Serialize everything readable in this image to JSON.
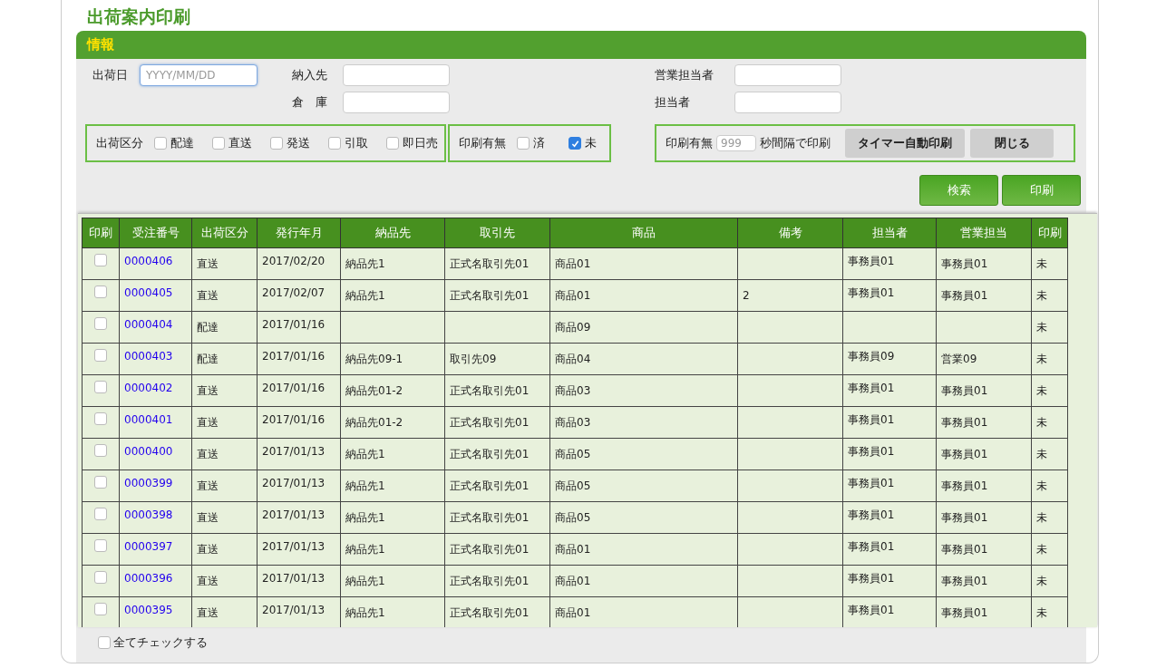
{
  "page_title": "出荷案内印刷",
  "panel": {
    "title": "情報",
    "fields": [
      {
        "label": "出荷日",
        "placeholder": "YYYY/MM/DD",
        "focused": true
      },
      {
        "label": "納入先"
      },
      {
        "label": "倉　庫"
      },
      {
        "label": "営業担当者"
      },
      {
        "label": "担当者"
      }
    ],
    "shipping_type": {
      "label": "出荷区分",
      "options": [
        {
          "label": "配達",
          "checked": false
        },
        {
          "label": "直送",
          "checked": false
        },
        {
          "label": "発送",
          "checked": false
        },
        {
          "label": "引取",
          "checked": false
        },
        {
          "label": "即日売",
          "checked": false
        }
      ]
    },
    "print_status": {
      "label": "印刷有無",
      "options": [
        {
          "label": "済",
          "checked": false
        },
        {
          "label": "未",
          "checked": true
        }
      ]
    },
    "timer": {
      "label": "印刷有無",
      "placeholder": "999",
      "suffix": "秒間隔で印刷",
      "buttons": [
        "タイマー自動印刷",
        "閉じる"
      ]
    },
    "actions": [
      "検索",
      "印刷"
    ]
  },
  "table": {
    "columns": [
      "印刷",
      "受注番号",
      "出荷区分",
      "発行年月",
      "納品先",
      "取引先",
      "商品",
      "備考",
      "担当者",
      "営業担当",
      "印刷"
    ],
    "rows": [
      {
        "checked": false,
        "order_no": "0000406",
        "type": "直送",
        "date": "2017/02/20",
        "dest": "納品先1",
        "client": "正式名取引先01",
        "product": "商品01",
        "note": "",
        "staff": "事務員01",
        "sales": "事務員01",
        "printed": "未"
      },
      {
        "checked": false,
        "order_no": "0000405",
        "type": "直送",
        "date": "2017/02/07",
        "dest": "納品先1",
        "client": "正式名取引先01",
        "product": "商品01",
        "note": "2",
        "staff": "事務員01",
        "sales": "事務員01",
        "printed": "未"
      },
      {
        "checked": false,
        "order_no": "0000404",
        "type": "配達",
        "date": "2017/01/16",
        "dest": "",
        "client": "",
        "product": "商品09",
        "note": "",
        "staff": "",
        "sales": "",
        "printed": "未"
      },
      {
        "checked": false,
        "order_no": "0000403",
        "type": "配達",
        "date": "2017/01/16",
        "dest": "納品先09-1",
        "client": "取引先09",
        "product": "商品04",
        "note": "",
        "staff": "事務員09",
        "sales": "営業09",
        "printed": "未"
      },
      {
        "checked": false,
        "order_no": "0000402",
        "type": "直送",
        "date": "2017/01/16",
        "dest": "納品先01-2",
        "client": "正式名取引先01",
        "product": "商品03",
        "note": "",
        "staff": "事務員01",
        "sales": "事務員01",
        "printed": "未"
      },
      {
        "checked": false,
        "order_no": "0000401",
        "type": "直送",
        "date": "2017/01/16",
        "dest": "納品先01-2",
        "client": "正式名取引先01",
        "product": "商品03",
        "note": "",
        "staff": "事務員01",
        "sales": "事務員01",
        "printed": "未"
      },
      {
        "checked": false,
        "order_no": "0000400",
        "type": "直送",
        "date": "2017/01/13",
        "dest": "納品先1",
        "client": "正式名取引先01",
        "product": "商品05",
        "note": "",
        "staff": "事務員01",
        "sales": "事務員01",
        "printed": "未"
      },
      {
        "checked": false,
        "order_no": "0000399",
        "type": "直送",
        "date": "2017/01/13",
        "dest": "納品先1",
        "client": "正式名取引先01",
        "product": "商品05",
        "note": "",
        "staff": "事務員01",
        "sales": "事務員01",
        "printed": "未"
      },
      {
        "checked": false,
        "order_no": "0000398",
        "type": "直送",
        "date": "2017/01/13",
        "dest": "納品先1",
        "client": "正式名取引先01",
        "product": "商品05",
        "note": "",
        "staff": "事務員01",
        "sales": "事務員01",
        "printed": "未"
      },
      {
        "checked": false,
        "order_no": "0000397",
        "type": "直送",
        "date": "2017/01/13",
        "dest": "納品先1",
        "client": "正式名取引先01",
        "product": "商品01",
        "note": "",
        "staff": "事務員01",
        "sales": "事務員01",
        "printed": "未"
      },
      {
        "checked": false,
        "order_no": "0000396",
        "type": "直送",
        "date": "2017/01/13",
        "dest": "納品先1",
        "client": "正式名取引先01",
        "product": "商品01",
        "note": "",
        "staff": "事務員01",
        "sales": "事務員01",
        "printed": "未"
      },
      {
        "checked": false,
        "order_no": "0000395",
        "type": "直送",
        "date": "2017/01/13",
        "dest": "納品先1",
        "client": "正式名取引先01",
        "product": "商品01",
        "note": "",
        "staff": "事務員01",
        "sales": "事務員01",
        "printed": "未"
      }
    ]
  },
  "check_all": {
    "label": "全てチェックする",
    "checked": false
  }
}
